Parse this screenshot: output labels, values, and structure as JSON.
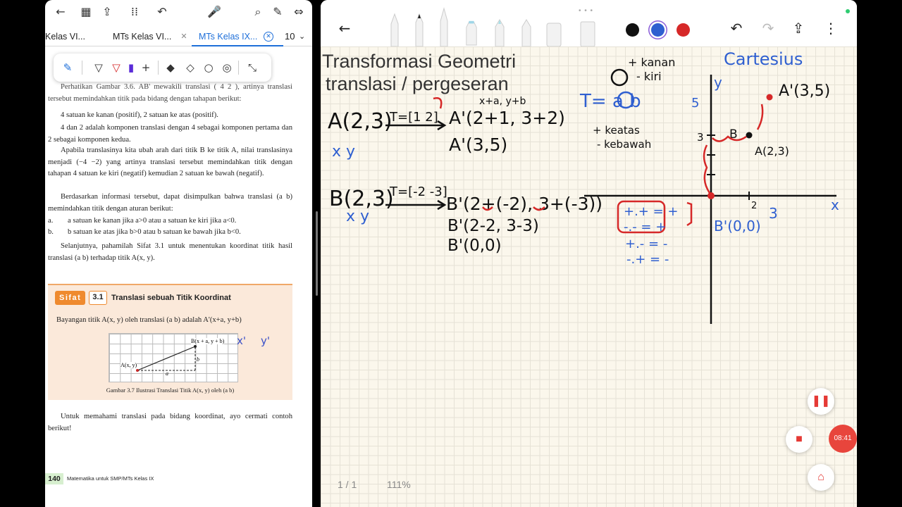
{
  "left_reader": {
    "tabs": [
      {
        "label": "Kelas VI...",
        "active": false
      },
      {
        "label": "MTs Kelas VI...",
        "active": false
      },
      {
        "label": "MTs Kelas IX...",
        "active": true
      }
    ],
    "tab_count": "10",
    "document": {
      "p1": "Perhatikan Gambar 3.6. AB' mewakili translasi ( 4 2 ), artinya translasi tersebut memindahkan titik pada bidang dengan tahapan berikut:",
      "p2": "4 satuan ke kanan (positif), 2 satuan ke atas (positif).",
      "p3": "4 dan 2 adalah komponen translasi dengan 4 sebagai komponen pertama dan 2 sebagai komponen kedua.",
      "p4": "Apabila translasinya kita ubah arah dari titik B ke titik A, nilai translasinya menjadi (−4 −2) yang artinya translasi tersebut memindahkan titik dengan tahapan 4 satuan ke kiri (negatif) kemudian 2 satuan ke bawah (negatif).",
      "p5": "Berdasarkan informasi tersebut, dapat disimpulkan bahwa translasi (a b) memindahkan titik dengan aturan berikut:",
      "list": [
        {
          "label": "a.",
          "text": "a satuan ke kanan jika a>0 atau a satuan ke kiri jika a<0."
        },
        {
          "label": "b.",
          "text": "b satuan ke atas jika b>0 atau b satuan ke bawah jika b<0."
        }
      ],
      "p6": "Selanjutnya, pahamilah Sifat 3.1 untuk menentukan koordinat titik hasil translasi (a b) terhadap titik A(x, y).",
      "sifat": {
        "label": "Sifat",
        "number": "3.1",
        "title": "Translasi sebuah Titik Koordinat",
        "text": "Bayangan titik A(x, y) oleh translasi (a b) adalah A'(x+a, y+b)",
        "figure_labels": {
          "a_point": "A(x, y)",
          "b_point": "B(x + a, y + b)",
          "a": "a",
          "b": "b"
        },
        "handwriting": [
          "x'",
          "y'"
        ],
        "caption": "Gambar 3.7 Ilustrasi Translasi Titik A(x, y) oleh (a b)"
      },
      "p7": "Untuk memahami translasi pada bidang koordinat, ayo cermati contoh berikut!"
    },
    "footer": {
      "page_number": "140",
      "text": "Matematika untuk SMP/MTs Kelas IX"
    }
  },
  "notes_app": {
    "title_line1": "Transformasi Geometri",
    "title_line2": "translasi / pergeseran",
    "colors": {
      "black": "#111111",
      "blue": "#2f5fd0",
      "red": "#d62828"
    },
    "page_indicator": "1 / 1",
    "zoom": "111%",
    "handwriting": {
      "ex1_point": "A(2,3)",
      "ex1_T": "T=[1 2]",
      "ex1_step1": "A'(2+1, 3+2)",
      "ex1_step2": "A'(3,5)",
      "ex1_top": "x+a, y+b",
      "ex2_point": "B(2,3)",
      "ex2_T": "T=[-2 -3]",
      "ex2_step1": "B'(2+(-2), 3+(-3))",
      "ex2_step2": "B'(2-2, 3-3)",
      "ex2_step3": "B'(0,0)",
      "xy1": "x y",
      "xy2": "x y",
      "T_def": "T= a b",
      "kanan": "+ kanan",
      "kiri": "- kiri",
      "keatas": "+ keatas",
      "kebawah": "- kebawah",
      "cartesius": "Cartesius",
      "pt_A": "A(2,3)",
      "pt_A_prime": "A'(3,5)",
      "pt_B": "B",
      "pt_B_prime": "B'(0,0)",
      "axis_x": "x",
      "axis_y": "y",
      "signs": [
        "+.+ = +",
        "-.- = +",
        "+.- = -",
        "-.+ = -"
      ],
      "tick_5": "5",
      "tick_3": "3",
      "tick_2": "2",
      "tick_3x": "3"
    },
    "recording": {
      "time": "08:41"
    }
  }
}
